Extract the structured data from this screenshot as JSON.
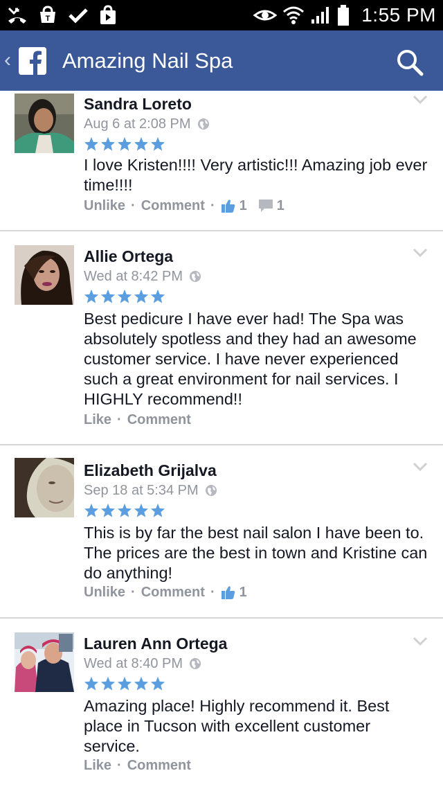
{
  "status_bar": {
    "time": "1:55 PM",
    "left_icons": [
      "missed-call-icon",
      "t-mobile-icon",
      "check-icon",
      "shopping-bag-icon"
    ],
    "right_icons": [
      "eye-icon",
      "wifi-icon",
      "signal-icon",
      "battery-icon"
    ]
  },
  "header": {
    "back_glyph": "‹",
    "logo_letter": "f",
    "title": "Amazing Nail Spa"
  },
  "colors": {
    "brand": "#3b5998",
    "star": "#5b9ee0",
    "meta": "#90949c"
  },
  "reviews": [
    {
      "name": "Sandra Loreto",
      "time": "Aug 6 at 2:08 PM",
      "rating": 5,
      "text": "I love Kristen!!!! Very artistic!!! Amazing job ever time!!!!",
      "like_label": "Unlike",
      "comment_label": "Comment",
      "likes": "1",
      "comments": "1"
    },
    {
      "name": "Allie Ortega",
      "time": "Wed at 8:42 PM",
      "rating": 5,
      "text": "Best pedicure I have ever had! The Spa was absolutely spotless and they had an awesome customer service. I have never experienced such a great environment for nail services. I HIGHLY recommend!!",
      "like_label": "Like",
      "comment_label": "Comment"
    },
    {
      "name": "Elizabeth Grijalva",
      "time": "Sep 18 at 5:34 PM",
      "rating": 5,
      "text": "This is by far the best nail salon I have been to.  The prices are the best in town and Kristine can do anything!",
      "like_label": "Unlike",
      "comment_label": "Comment",
      "likes": "1"
    },
    {
      "name": "Lauren Ann Ortega",
      "time": "Wed at 8:40 PM",
      "rating": 5,
      "text": "Amazing place! Highly recommend it. Best place in Tucson with excellent customer service.",
      "like_label": "Like",
      "comment_label": "Comment"
    }
  ],
  "separator": "·"
}
